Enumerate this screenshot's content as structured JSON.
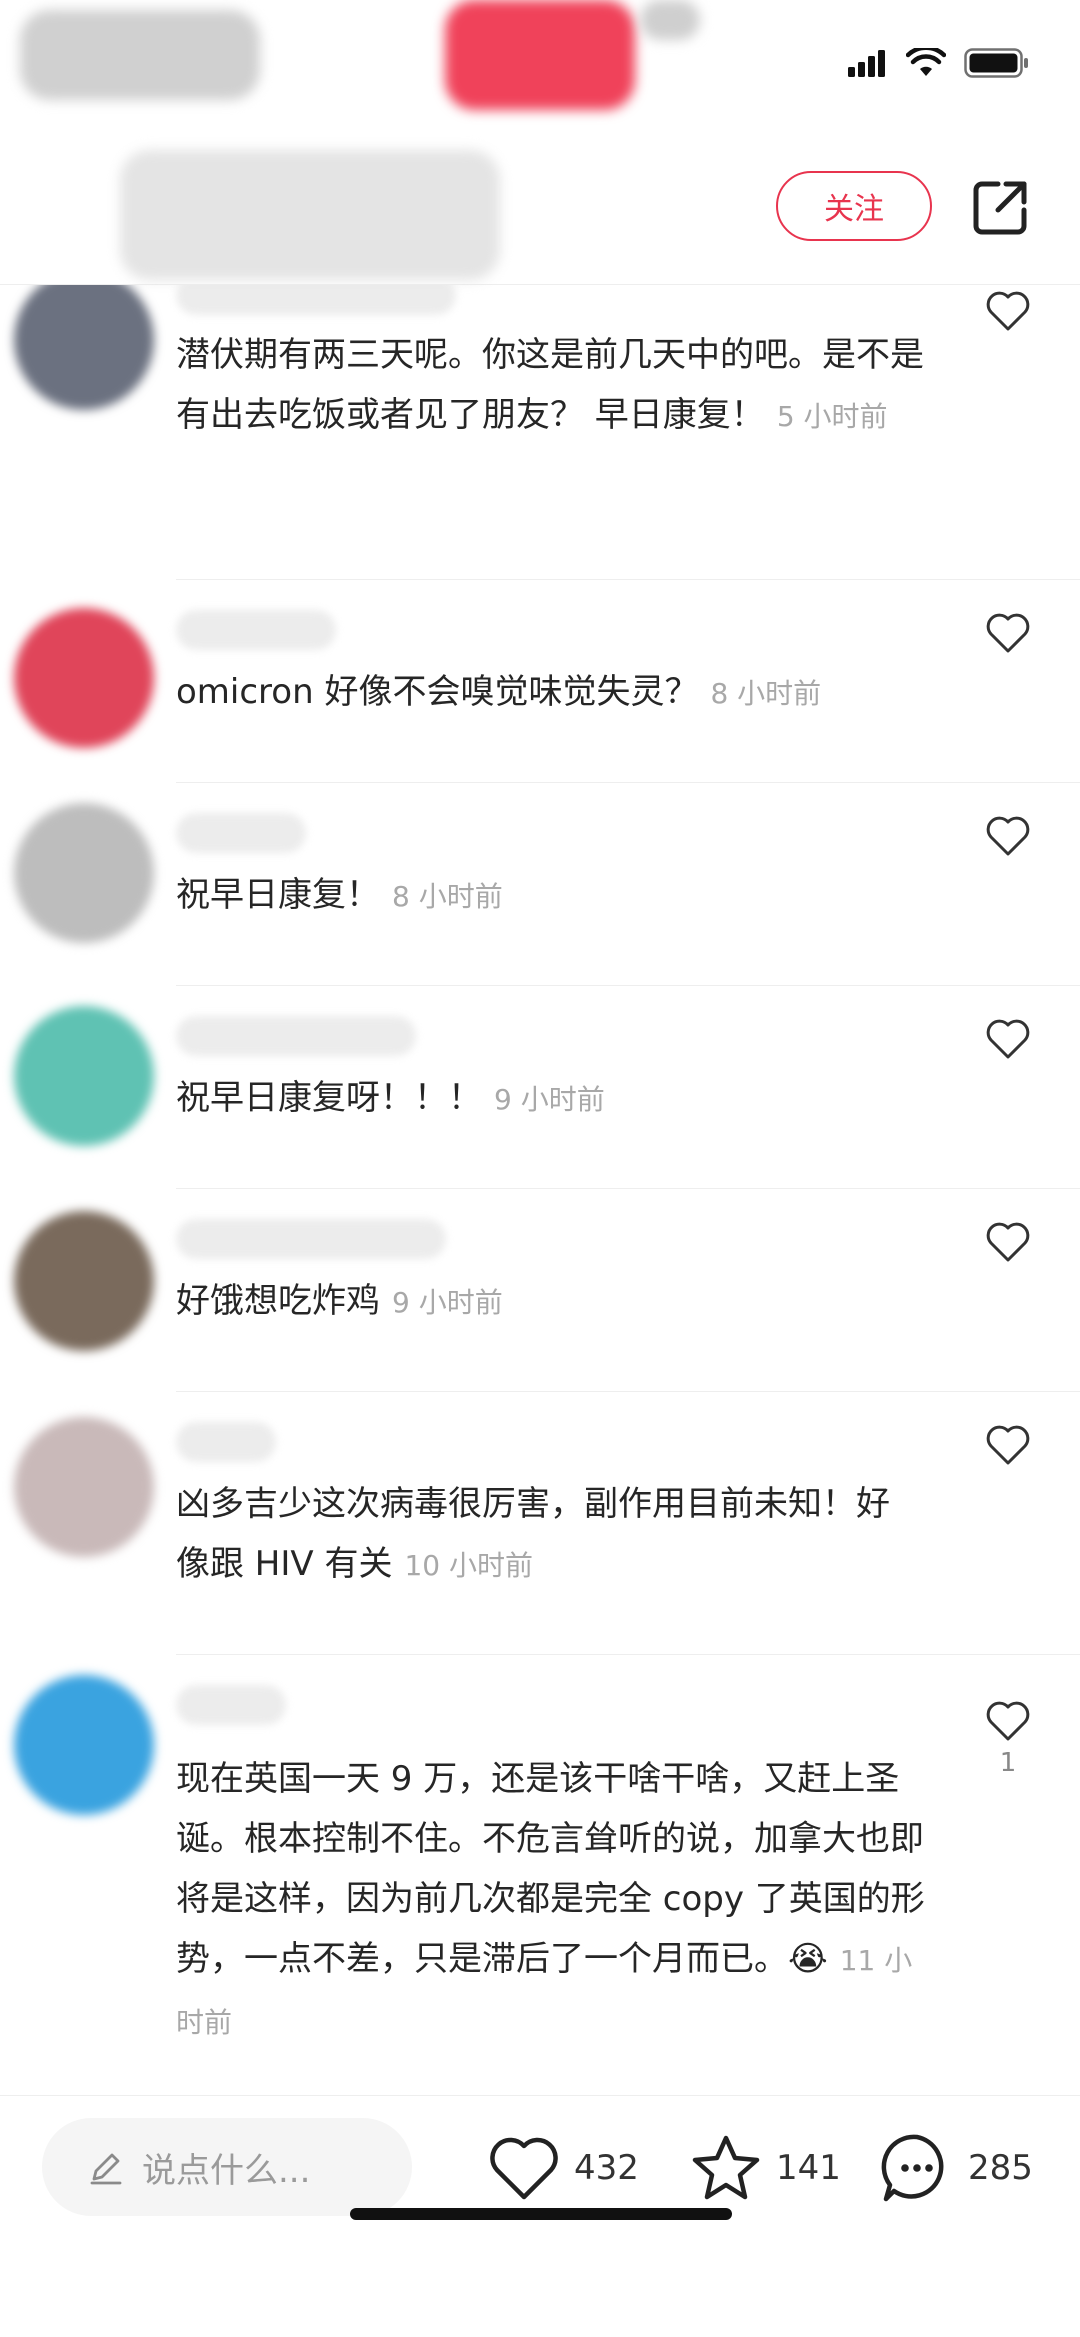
{
  "colors": {
    "accent": "#e8344e",
    "muted": "#a8a8a8",
    "text": "#262626"
  },
  "header": {
    "follow_label": "关注",
    "share_icon": "share-out-icon"
  },
  "comments": [
    {
      "text": "潜伏期有两三天呢。你这是前几天中的吧。是不是有出去吃饭或者见了朋友？ 早日康复！",
      "time": "5 小时前",
      "avatar_color": "#6b7180",
      "like_count": ""
    },
    {
      "text": "omicron 好像不会嗅觉味觉失灵？",
      "time": "8 小时前",
      "avatar_color": "#e0455a",
      "like_count": ""
    },
    {
      "text": "祝早日康复！",
      "time": "8 小时前",
      "avatar_color": "#bdbdbd",
      "like_count": ""
    },
    {
      "text": "祝早日康复呀！！！",
      "time": "9 小时前",
      "avatar_color": "#5fc2b3",
      "like_count": ""
    },
    {
      "text": "好饿想吃炸鸡",
      "time": "9 小时前",
      "avatar_color": "#7a6a5c",
      "like_count": ""
    },
    {
      "text": "凶多吉少这次病毒很厉害，副作用目前未知！好像跟 HIV 有关",
      "time": "10 小时前",
      "avatar_color": "#c9b9b9",
      "like_count": ""
    },
    {
      "text": "现在英国一天 9 万，还是该干啥干啥，又赶上圣诞。根本控制不住。不危言耸听的说，加拿大也即将是这样，因为前几次都是完全 copy 了英国的形势，一点不差，只是滞后了一个月而已。😭",
      "time": "11 小时前",
      "avatar_color": "#3aa3e0",
      "like_count": "1"
    }
  ],
  "bottom_bar": {
    "input_placeholder": "说点什么...",
    "likes": "432",
    "favorites": "141",
    "comments": "285"
  }
}
